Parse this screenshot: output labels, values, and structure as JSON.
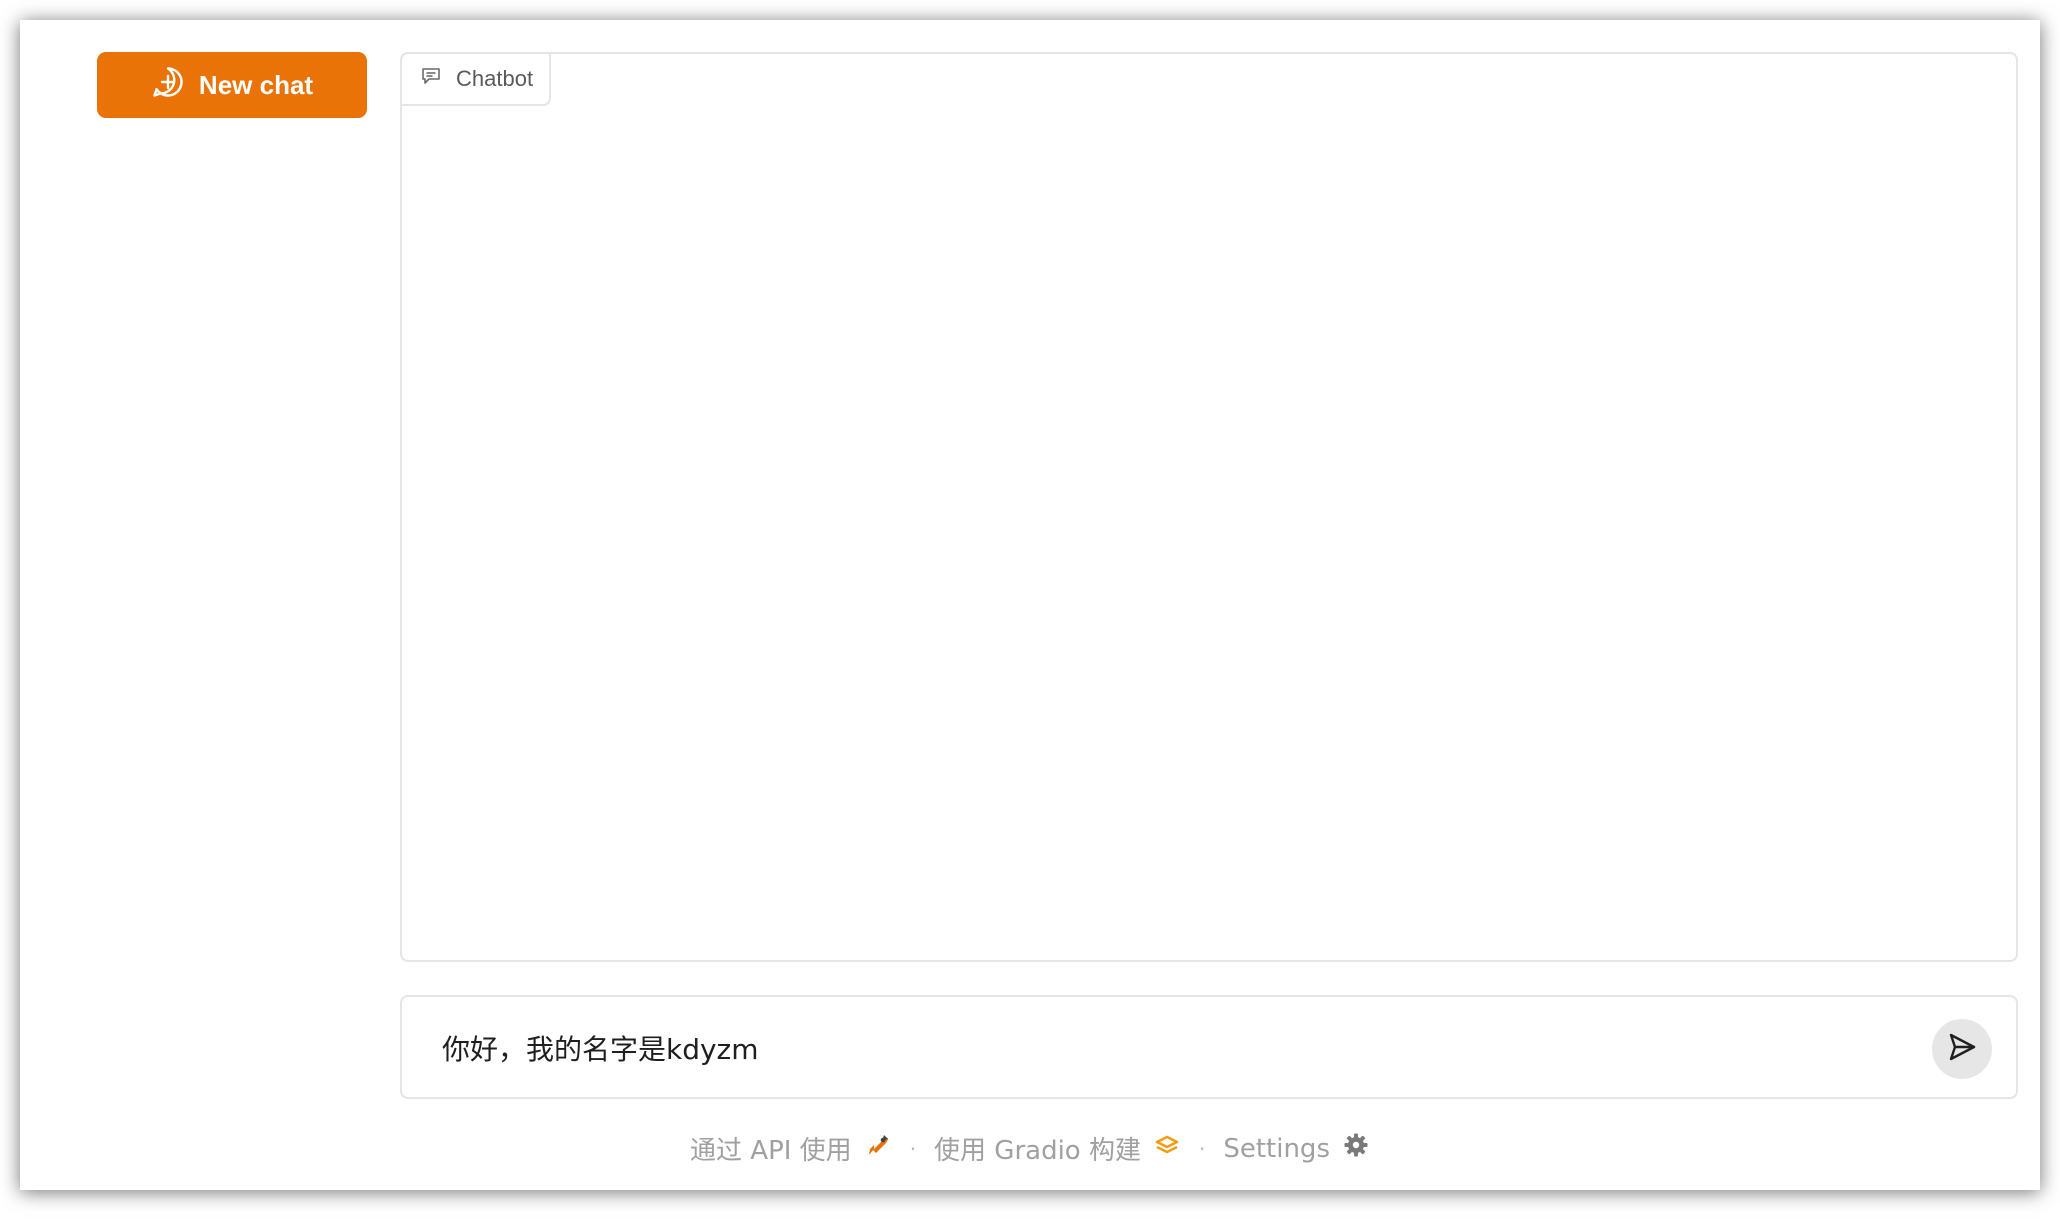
{
  "sidebar": {
    "new_chat_label": "New chat",
    "new_chat_icon": "chat-plus-icon"
  },
  "chatbot": {
    "label": "Chatbot",
    "label_icon": "chat-bubble-icon"
  },
  "input": {
    "value": "你好，我的名字是kdyzm",
    "send_icon": "send-icon"
  },
  "footer": {
    "api_label": "通过 API 使用",
    "api_icon": "rocket-icon",
    "separator": "·",
    "built_label": "使用 Gradio 构建",
    "built_icon": "gradio-logo-icon",
    "settings_label": "Settings",
    "settings_icon": "gear-icon"
  },
  "colors": {
    "accent": "#ea7307",
    "border": "#e5e5e5",
    "footer_text": "#a0a0a0"
  }
}
